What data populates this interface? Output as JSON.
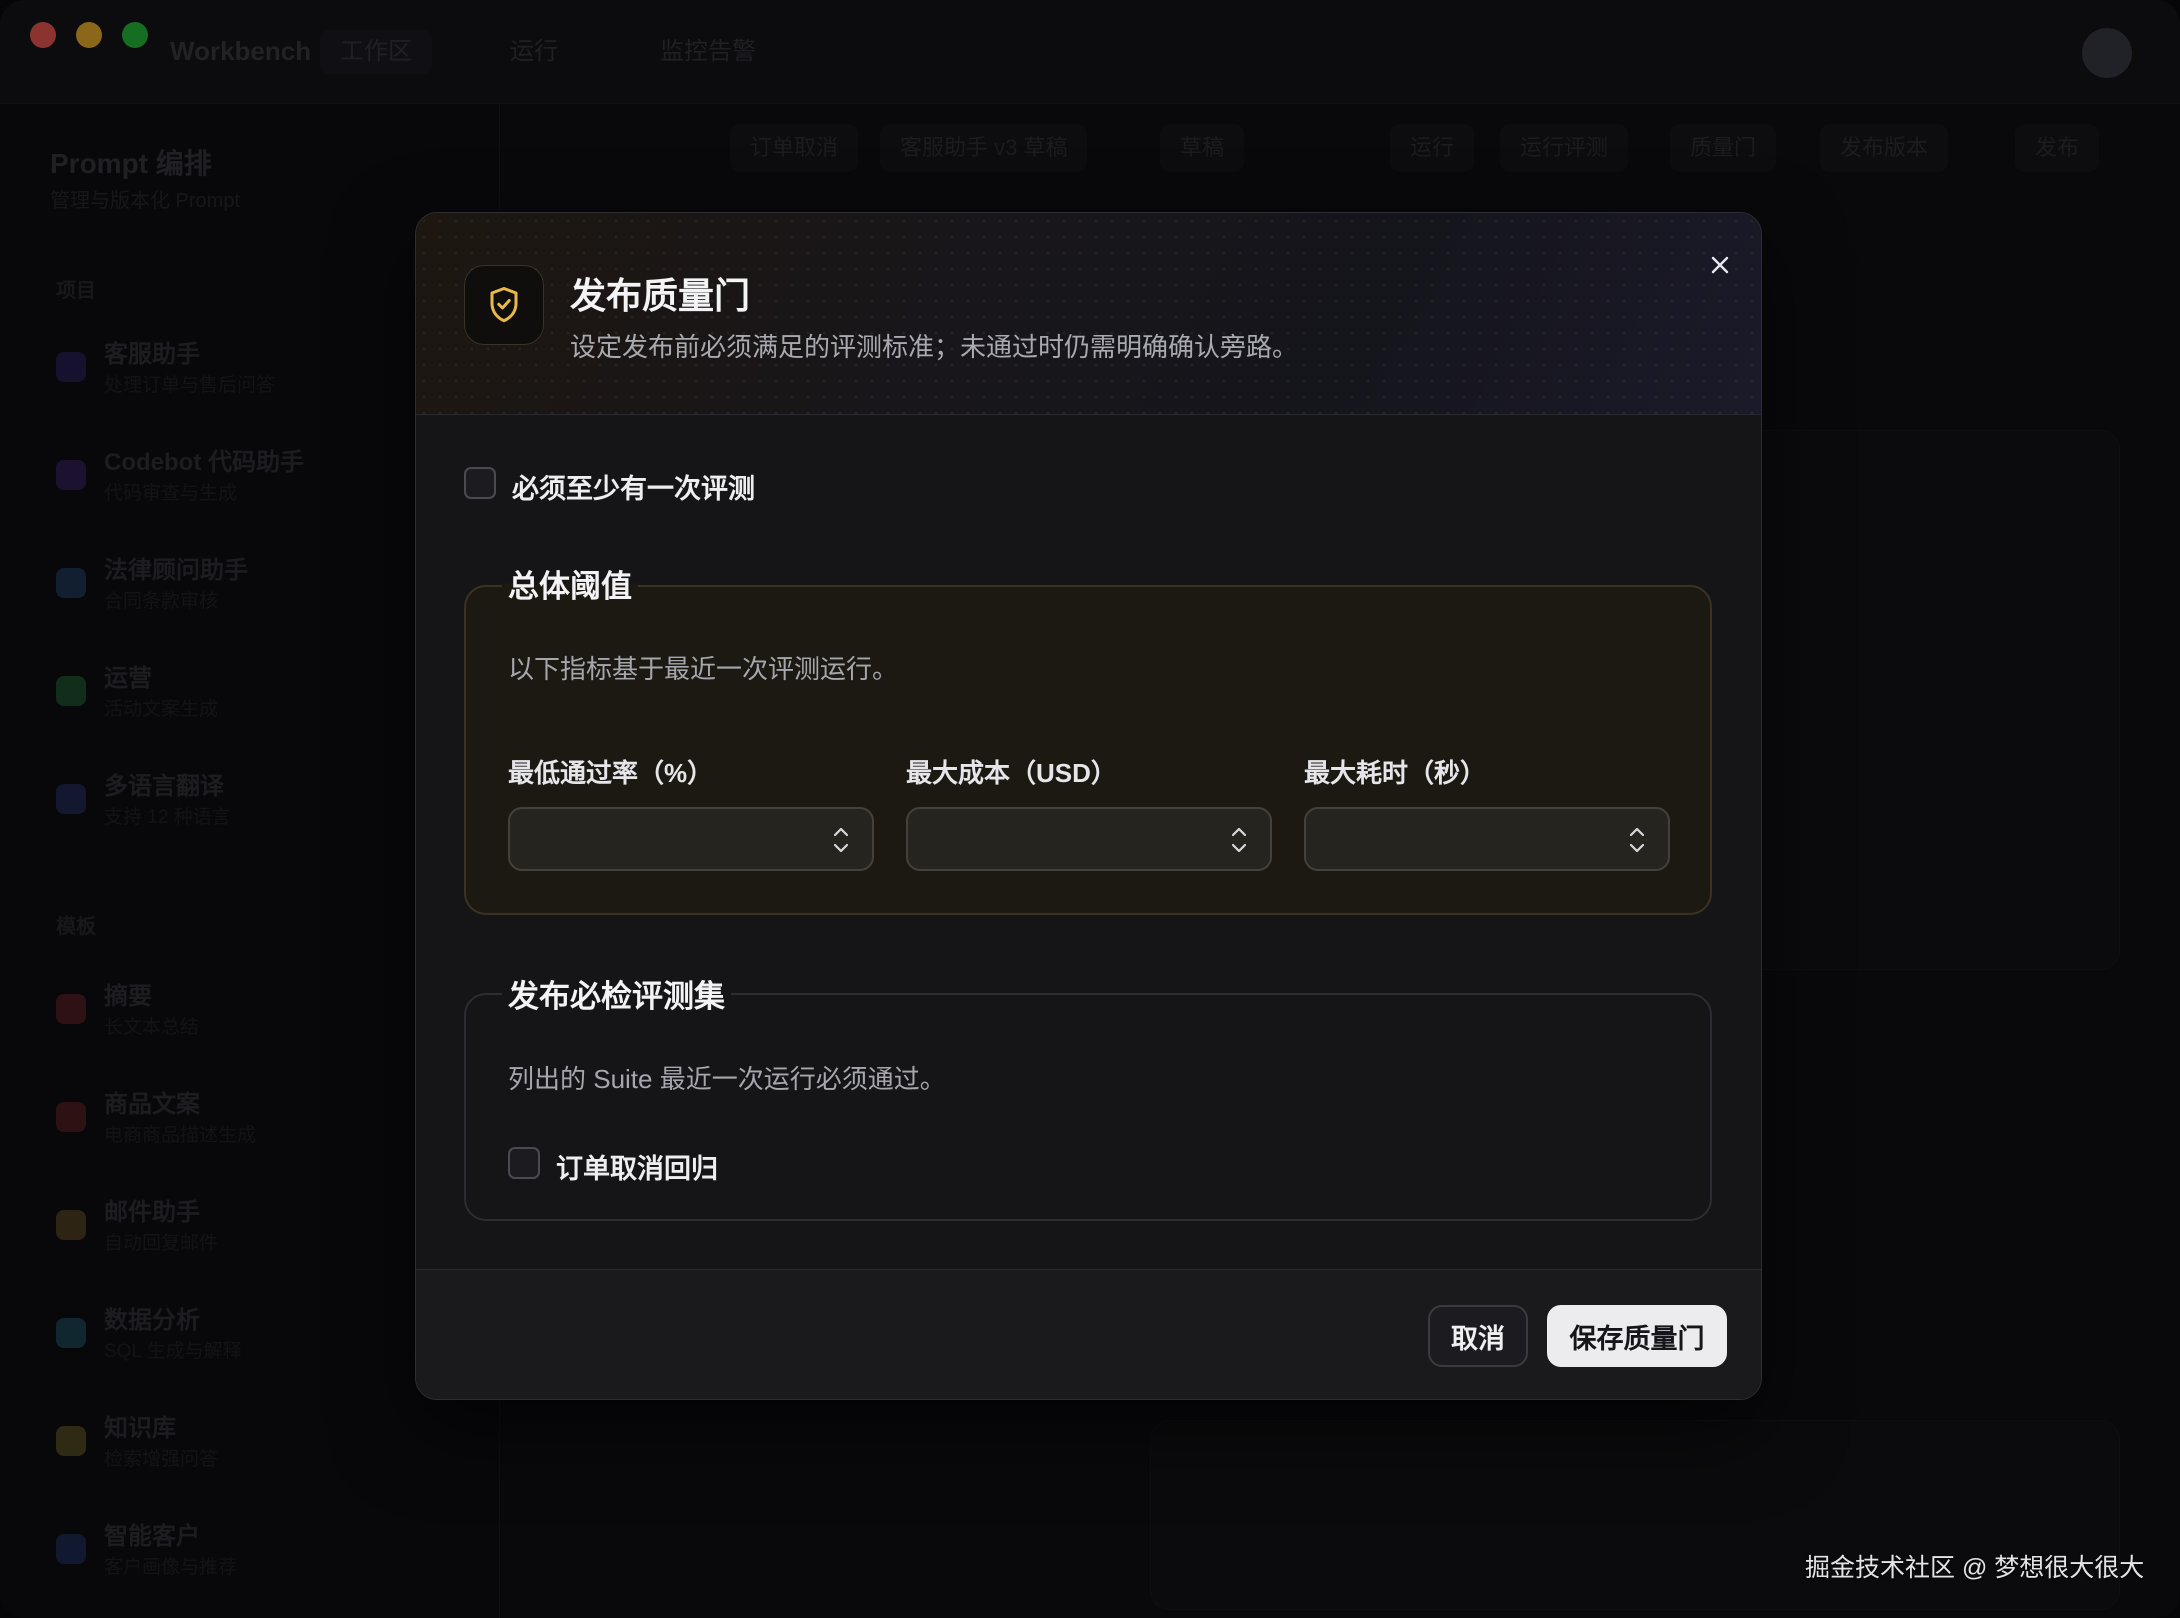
{
  "background_app": {
    "app_name": "Workbench",
    "tabs": [
      "工作区",
      "运行",
      "监控告警"
    ],
    "sidebar": {
      "title": "Prompt 编排",
      "subtitle": "管理与版本化 Prompt",
      "sections": [
        "项目",
        "模板"
      ],
      "items": [
        {
          "name": "客服助手",
          "desc": "处理订单与售后问答",
          "color": "#5b3fd6"
        },
        {
          "name": "Codebot 代码助手",
          "desc": "代码审查与生成",
          "color": "#7a3fd6"
        },
        {
          "name": "法律顾问助手",
          "desc": "合同条款审核",
          "color": "#3f8ad6"
        },
        {
          "name": "运营",
          "desc": "活动文案生成",
          "color": "#3fd66a"
        },
        {
          "name": "多语言翻译",
          "desc": "支持 12 种语言",
          "color": "#4f5bd6"
        },
        {
          "name": "摘要",
          "desc": "长文本总结",
          "color": "#d63f4a"
        },
        {
          "name": "商品文案",
          "desc": "电商商品描述生成",
          "color": "#d63f3f"
        },
        {
          "name": "邮件助手",
          "desc": "自动回复邮件",
          "color": "#d6a03f"
        },
        {
          "name": "数据分析",
          "desc": "SQL 生成与解释",
          "color": "#3fb0d6"
        },
        {
          "name": "知识库",
          "desc": "检索增强问答",
          "color": "#d6c03f"
        },
        {
          "name": "智能客户",
          "desc": "客户画像与推荐",
          "color": "#3f6ad6"
        }
      ]
    },
    "toolbar": {
      "chips": [
        "订单取消",
        "客服助手 v3 草稿",
        "草稿",
        "运行",
        "运行评测",
        "质量门",
        "发布版本",
        "发布"
      ]
    }
  },
  "modal": {
    "title": "发布质量门",
    "subtitle": "设定发布前必须满足的评测标准；未通过时仍需明确确认旁路。",
    "require_eval_label": "必须至少有一次评测",
    "threshold": {
      "legend": "总体阈值",
      "help": "以下指标基于最近一次评测运行。",
      "fields": [
        {
          "label": "最低通过率（%）",
          "value": ""
        },
        {
          "label": "最大成本（USD）",
          "value": ""
        },
        {
          "label": "最大耗时（秒）",
          "value": ""
        }
      ]
    },
    "suites": {
      "legend": "发布必检评测集",
      "help": "列出的 Suite 最近一次运行必须通过。",
      "items": [
        {
          "label": "订单取消回归",
          "checked": false
        }
      ]
    },
    "footer": {
      "cancel_label": "取消",
      "save_label": "保存质量门"
    },
    "accent_color": "#e8b84a"
  },
  "watermark": "掘金技术社区 @ 梦想很大很大"
}
